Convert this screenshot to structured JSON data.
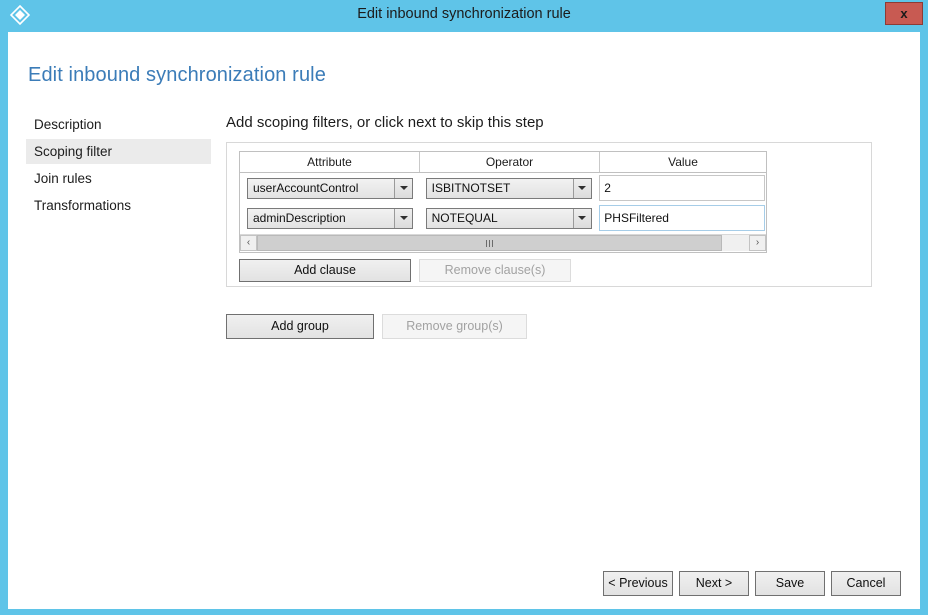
{
  "window": {
    "title": "Edit inbound synchronization rule",
    "icon": "azure-diamond-icon",
    "close_label": "x",
    "titlebar_color": "#5FC4E8",
    "close_button_color": "#c85a52"
  },
  "page": {
    "heading": "Edit inbound synchronization rule",
    "heading_color": "#3b7cb8"
  },
  "sidebar": {
    "items": [
      {
        "label": "Description",
        "selected": false
      },
      {
        "label": "Scoping filter",
        "selected": true
      },
      {
        "label": "Join rules",
        "selected": false
      },
      {
        "label": "Transformations",
        "selected": false
      }
    ],
    "selected_background": "#ebebeb"
  },
  "main": {
    "instruction": "Add scoping filters, or click next to skip this step",
    "grid": {
      "columns": [
        "Attribute",
        "Operator",
        "Value"
      ],
      "rows": [
        {
          "attribute": "userAccountControl",
          "operator": "ISBITNOTSET",
          "value": "2",
          "value_placeholder": "",
          "value_focused": false
        },
        {
          "attribute": "adminDescription",
          "operator": "NOTEQUAL",
          "value": "PHSFiltered",
          "value_placeholder": "",
          "value_focused": true
        }
      ],
      "scrollbar": {
        "left_arrow": "‹",
        "right_arrow": "›",
        "orientation": "horizontal"
      }
    },
    "clause_buttons": {
      "add": {
        "label": "Add clause",
        "enabled": true
      },
      "remove": {
        "label": "Remove clause(s)",
        "enabled": false
      }
    },
    "group_buttons": {
      "add": {
        "label": "Add group",
        "enabled": true
      },
      "remove": {
        "label": "Remove group(s)",
        "enabled": false
      }
    }
  },
  "footer": {
    "buttons": [
      {
        "label": "< Previous"
      },
      {
        "label": "Next >"
      },
      {
        "label": "Save"
      },
      {
        "label": "Cancel"
      }
    ]
  }
}
